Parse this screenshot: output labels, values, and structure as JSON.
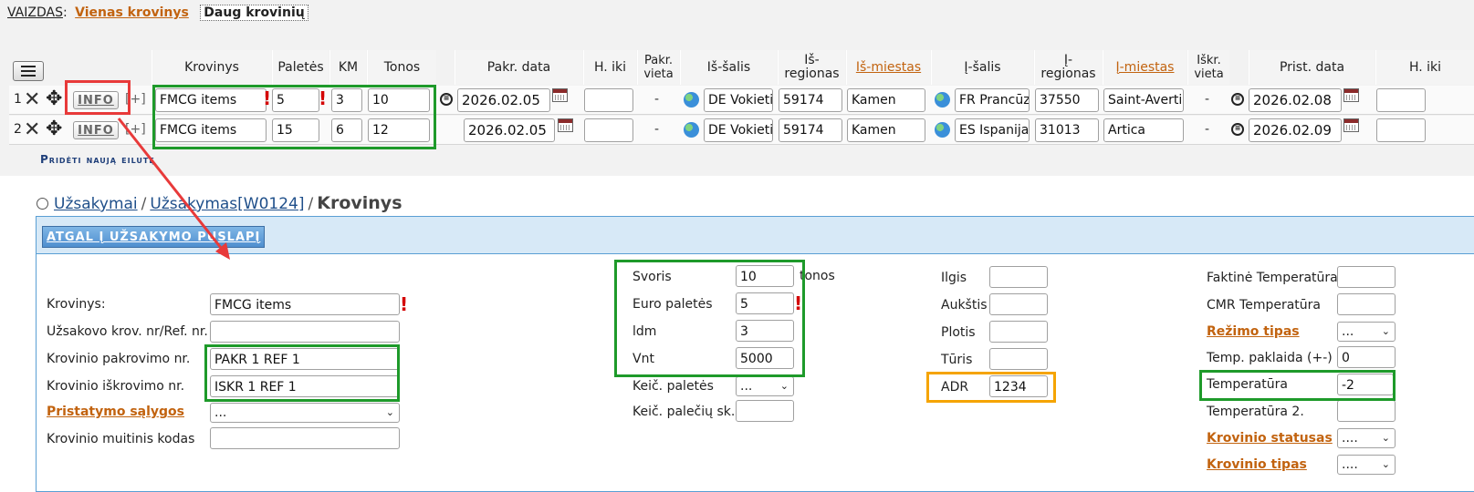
{
  "view": {
    "label": "VAIZDAS",
    "colon": ":",
    "single_link": "Vienas krovinys",
    "multi_active": "Daug krovinių"
  },
  "table_headers": {
    "krovinys": "Krovinys",
    "paletes": "Paletės",
    "km": "KM",
    "tonos": "Tonos",
    "pakr_data": "Pakr. data",
    "h_iki": "H. iki",
    "pakr_vieta": "Pakr. vieta",
    "is_salis": "Iš-šalis",
    "is_regionas": "Iš- regionas",
    "is_miestas": "Iš-miestas",
    "i_salis": "Į-šalis",
    "i_regionas": "Į- regionas",
    "i_miestas": "Į-miestas",
    "iskr_vieta": "Iškr. vieta",
    "prist_data": "Prist. data",
    "h_iki_2": "H. iki"
  },
  "rows": [
    {
      "num": "1",
      "info": "INFO",
      "plus": "[+]",
      "krovinys": "FMCG items",
      "paletes": "5",
      "km": "3",
      "tonos": "10",
      "pakr_data": "2026.02.05",
      "h_iki": "",
      "pakr_vieta": "-",
      "is_salis": "DE Vokietija",
      "is_regionas": "59174",
      "is_miestas": "Kamen",
      "i_salis": "FR Prancūzija",
      "i_regionas": "37550",
      "i_miestas": "Saint-Avertin",
      "iskr_vieta": "-",
      "prist_data": "2026.02.08",
      "h_iki_2": ""
    },
    {
      "num": "2",
      "info": "INFO",
      "plus": "[+]",
      "krovinys": "FMCG items",
      "paletes": "15",
      "km": "6",
      "tonos": "12",
      "pakr_data": "2026.02.05",
      "h_iki": "",
      "pakr_vieta": "-",
      "is_salis": "DE Vokietija",
      "is_regionas": "59174",
      "is_miestas": "Kamen",
      "i_salis": "ES Ispanija",
      "i_regionas": "31013",
      "i_miestas": "Artica",
      "iskr_vieta": "-",
      "prist_data": "2026.02.09",
      "h_iki_2": ""
    }
  ],
  "add_row": "Pridėti naują eilutę",
  "breadcrumb": {
    "item1": "Užsakymai",
    "sep": "/",
    "item2": "Užsakymas[W0124]",
    "current": "Krovinys"
  },
  "back_button": "ATGAL Į UŽSAKYMO PUSLAPĮ",
  "form": {
    "col1": [
      {
        "label": "Krovinys:",
        "value": "FMCG items",
        "link": false
      },
      {
        "label": "Užsakovo krov. nr/Ref. nr.",
        "value": "",
        "link": false
      },
      {
        "label": "Krovinio pakrovimo nr.",
        "value": "PAKR 1 REF 1",
        "link": false
      },
      {
        "label": "Krovinio iškrovimo nr.",
        "value": "ISKR 1 REF 1",
        "link": false
      },
      {
        "label": "Pristatymo sąlygos",
        "value": "...",
        "link": true
      },
      {
        "label": "Krovinio muitinis kodas",
        "value": "",
        "link": false
      }
    ],
    "col2": [
      {
        "label": "Svoris",
        "value": "10",
        "unit": "tonos"
      },
      {
        "label": "Euro paletės",
        "value": "5"
      },
      {
        "label": "ldm",
        "value": "3"
      },
      {
        "label": "Vnt",
        "value": "5000"
      },
      {
        "label": "Keič. paletės",
        "value": "..."
      },
      {
        "label": "Keič. palečių sk.",
        "value": ""
      }
    ],
    "col3": [
      {
        "label": "Ilgis",
        "value": ""
      },
      {
        "label": "Aukštis",
        "value": ""
      },
      {
        "label": "Plotis",
        "value": ""
      },
      {
        "label": "Tūris",
        "value": ""
      },
      {
        "label": "ADR",
        "value": "1234"
      }
    ],
    "col4": [
      {
        "label": "Faktinė Temperatūra",
        "value": "",
        "link": false
      },
      {
        "label": "CMR Temperatūra",
        "value": "",
        "link": false
      },
      {
        "label": "Režimo tipas",
        "value": "...",
        "link": true
      },
      {
        "label": "Temp. paklaida (+-)",
        "value": "0",
        "link": false
      },
      {
        "label": "Temperatūra",
        "value": "-2",
        "link": false
      },
      {
        "label": "Temperatūra 2.",
        "value": "",
        "link": false
      },
      {
        "label": "Krovinio statusas",
        "value": "....",
        "link": true
      },
      {
        "label": "Krovinio tipas",
        "value": "....",
        "link": true
      }
    ]
  },
  "colors": {
    "highlight_green": "#1e9a2a",
    "highlight_red": "#e83a3a",
    "highlight_orange": "#f5a400",
    "link_orange": "#c2630f",
    "panel_blue": "#d7e9f7"
  }
}
